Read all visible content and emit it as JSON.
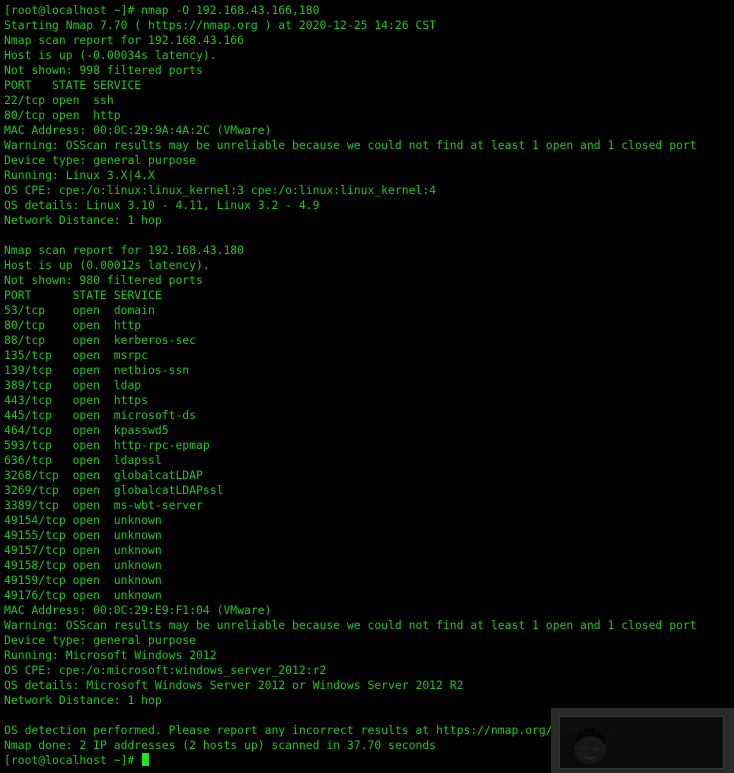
{
  "terminal": {
    "lines": [
      "[root@localhost ~]# nmap -O 192.168.43.166,180",
      "Starting Nmap 7.70 ( https://nmap.org ) at 2020-12-25 14:26 CST",
      "Nmap scan report for 192.168.43.166",
      "Host is up (-0.00034s latency).",
      "Not shown: 998 filtered ports",
      "PORT   STATE SERVICE",
      "22/tcp open  ssh",
      "80/tcp open  http",
      "MAC Address: 00:0C:29:9A:4A:2C (VMware)",
      "Warning: OSScan results may be unreliable because we could not find at least 1 open and 1 closed port",
      "Device type: general purpose",
      "Running: Linux 3.X|4.X",
      "OS CPE: cpe:/o:linux:linux_kernel:3 cpe:/o:linux:linux_kernel:4",
      "OS details: Linux 3.10 - 4.11, Linux 3.2 - 4.9",
      "Network Distance: 1 hop",
      "",
      "Nmap scan report for 192.168.43.180",
      "Host is up (0.00012s latency).",
      "Not shown: 980 filtered ports",
      "PORT      STATE SERVICE",
      "53/tcp    open  domain",
      "80/tcp    open  http",
      "88/tcp    open  kerberos-sec",
      "135/tcp   open  msrpc",
      "139/tcp   open  netbios-ssn",
      "389/tcp   open  ldap",
      "443/tcp   open  https",
      "445/tcp   open  microsoft-ds",
      "464/tcp   open  kpasswd5",
      "593/tcp   open  http-rpc-epmap",
      "636/tcp   open  ldapssl",
      "3268/tcp  open  globalcatLDAP",
      "3269/tcp  open  globalcatLDAPssl",
      "3389/tcp  open  ms-wbt-server",
      "49154/tcp open  unknown",
      "49155/tcp open  unknown",
      "49157/tcp open  unknown",
      "49158/tcp open  unknown",
      "49159/tcp open  unknown",
      "49176/tcp open  unknown",
      "MAC Address: 00:0C:29:E9:F1:04 (VMware)",
      "Warning: OSScan results may be unreliable because we could not find at least 1 open and 1 closed port",
      "Device type: general purpose",
      "Running: Microsoft Windows 2012",
      "OS CPE: cpe:/o:microsoft:windows_server_2012:r2",
      "OS details: Microsoft Windows Server 2012 or Windows Server 2012 R2",
      "Network Distance: 1 hop",
      "",
      "OS detection performed. Please report any incorrect results at https://nmap.org/submit/ .",
      "Nmap done: 2 IP addresses (2 hosts up) scanned in 37.70 seconds"
    ],
    "prompt": "[root@localhost ~]# ",
    "colors": {
      "background": "#000000",
      "text": "#1ec81e",
      "cursor": "#1ee61e"
    }
  }
}
